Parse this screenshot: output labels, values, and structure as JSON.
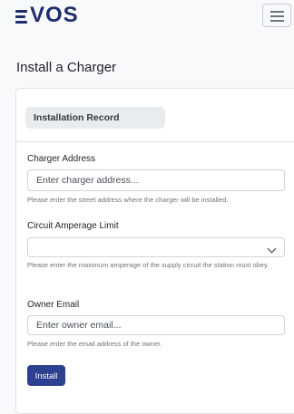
{
  "header": {
    "logo_text": "VOS",
    "logo_color": "#1f2d6b",
    "menu_icon": "hamburger-menu-icon"
  },
  "page": {
    "title": "Install a Charger"
  },
  "card": {
    "header_label": "Installation Record",
    "fields": {
      "address": {
        "label": "Charger Address",
        "placeholder": "Enter charger address...",
        "help": "Please enter the street address where the charger will be installed."
      },
      "amperage": {
        "label": "Circuit Amperage Limit",
        "selected": "",
        "help": "Please enter the maximum amperage of the supply circuit the station must obey."
      },
      "email": {
        "label": "Owner Email",
        "placeholder": "Enter owner email...",
        "help": "Please enter the email address of the owner."
      }
    },
    "submit_label": "Install",
    "accent_color": "#2e4090"
  }
}
